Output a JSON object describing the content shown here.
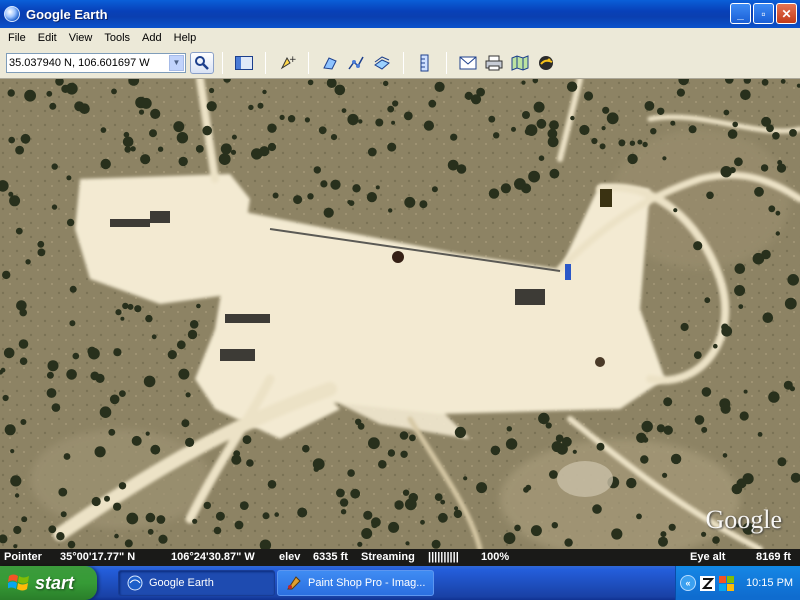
{
  "window": {
    "title": "Google Earth",
    "controls": {
      "minimize": "_",
      "restore": "▫",
      "close": "✕"
    }
  },
  "menu": [
    "File",
    "Edit",
    "View",
    "Tools",
    "Add",
    "Help"
  ],
  "search": {
    "value": "35.037940 N, 106.601697 W",
    "dropdown_glyph": "▼"
  },
  "toolbar": {
    "icons": [
      "sidebar-toggle-icon",
      "placemark-icon",
      "polygon-icon",
      "path-icon",
      "overlay-icon",
      "ruler-icon",
      "email-icon",
      "print-icon",
      "maps-icon",
      "sky-icon"
    ]
  },
  "map": {
    "watermark": "Google",
    "colors": {
      "soil": "#8d8364",
      "cleared": "#f3ead2",
      "trees": "#28301c"
    }
  },
  "status": {
    "pointer_label": "Pointer",
    "lat": "35°00'17.77\" N",
    "lon": "106°24'30.87\" W",
    "elev_label": "elev",
    "elev": "6335 ft",
    "streaming_label": "Streaming",
    "streaming_bars": "||||||||||",
    "streaming_pct": "100%",
    "eye_alt_label": "Eye alt",
    "eye_alt": "8169 ft"
  },
  "taskbar": {
    "start_label": "start",
    "tasks": [
      {
        "label": "Google Earth",
        "active": true
      },
      {
        "label": "Paint Shop Pro - Imag...",
        "active": false
      }
    ],
    "tray_chevron": "«",
    "clock": "10:15 PM"
  }
}
